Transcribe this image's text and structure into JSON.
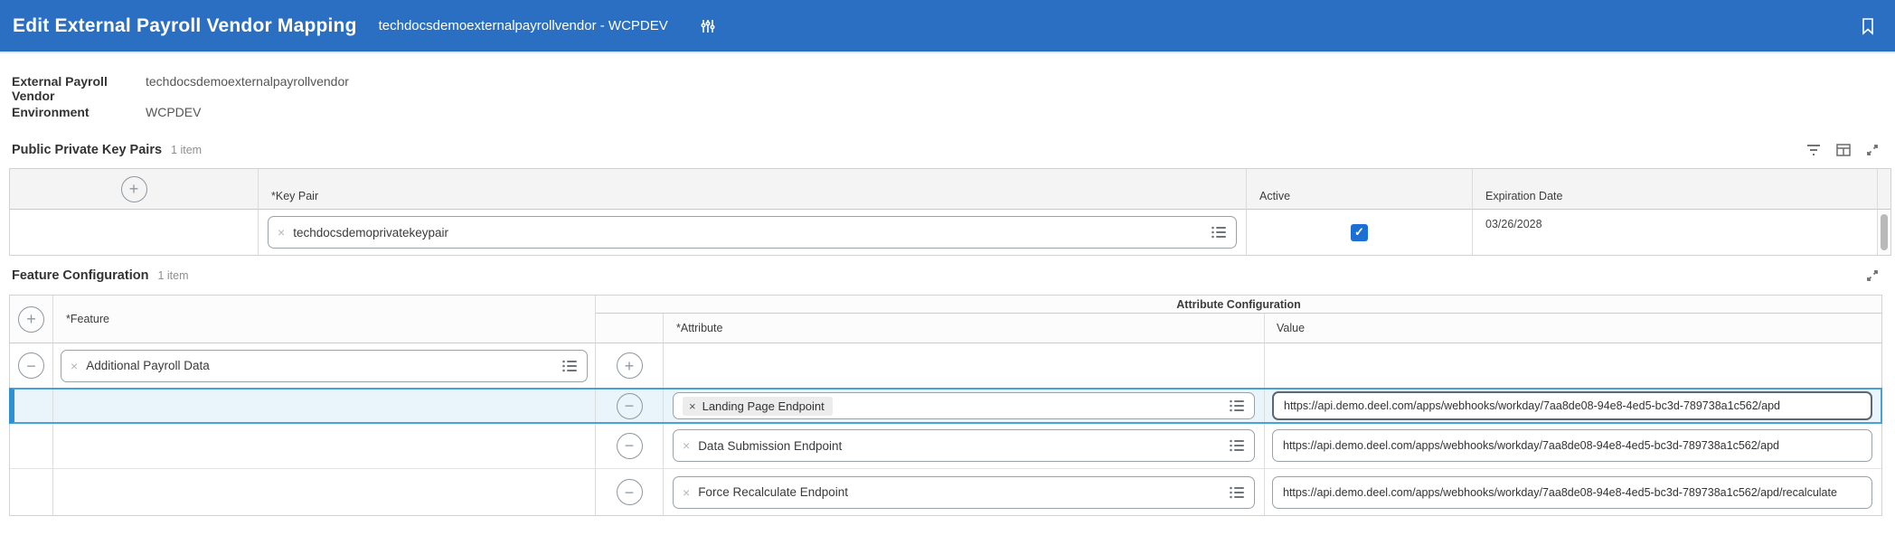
{
  "header": {
    "title": "Edit External Payroll Vendor Mapping",
    "subtitle": "techdocsdemoexternalpayrollvendor - WCPDEV"
  },
  "info_fields": {
    "vendor_label": "External Payroll Vendor",
    "vendor_value": "techdocsdemoexternalpayrollvendor",
    "environment_label": "Environment",
    "environment_value": "WCPDEV"
  },
  "key_pairs": {
    "section_title": "Public Private Key Pairs",
    "item_count": "1 item",
    "columns": {
      "key_pair": "*Key Pair",
      "active": "Active",
      "expiration_date": "Expiration Date"
    },
    "row": {
      "key_pair_value": "techdocsdemoprivatekeypair",
      "active_checked": true,
      "expiration_date": "03/26/2028"
    }
  },
  "feature_config": {
    "section_title": "Feature Configuration",
    "item_count": "1 item",
    "columns": {
      "feature": "*Feature",
      "attribute_group": "Attribute Configuration",
      "attribute": "*Attribute",
      "value": "Value"
    },
    "feature_value": "Additional Payroll Data",
    "attribute_rows": [
      {
        "attribute": "Landing Page Endpoint",
        "value": "https://api.demo.deel.com/apps/webhooks/workday/7aa8de08-94e8-4ed5-bc3d-789738a1c562/apd",
        "selected": true
      },
      {
        "attribute": "Data Submission Endpoint",
        "value": "https://api.demo.deel.com/apps/webhooks/workday/7aa8de08-94e8-4ed5-bc3d-789738a1c562/apd",
        "selected": false
      },
      {
        "attribute": "Force Recalculate Endpoint",
        "value": "https://api.demo.deel.com/apps/webhooks/workday/7aa8de08-94e8-4ed5-bc3d-789738a1c562/apd/recalculate",
        "selected": false
      }
    ]
  },
  "glyphs": {
    "add": "+",
    "remove": "−",
    "clear": "×",
    "check": "✓"
  },
  "icons": {
    "related_actions": "vertical-sliders",
    "bookmark": "bookmark-outline",
    "filter": "funnel",
    "grid": "table-columns",
    "expand": "expand-arrows",
    "prompt": "list-prompt"
  },
  "colors": {
    "header_blue": "#2b6fc2",
    "checkbox_blue": "#1d70d3",
    "selected_row_bg": "#e9f4fb",
    "selected_row_border": "#47a2dc"
  }
}
